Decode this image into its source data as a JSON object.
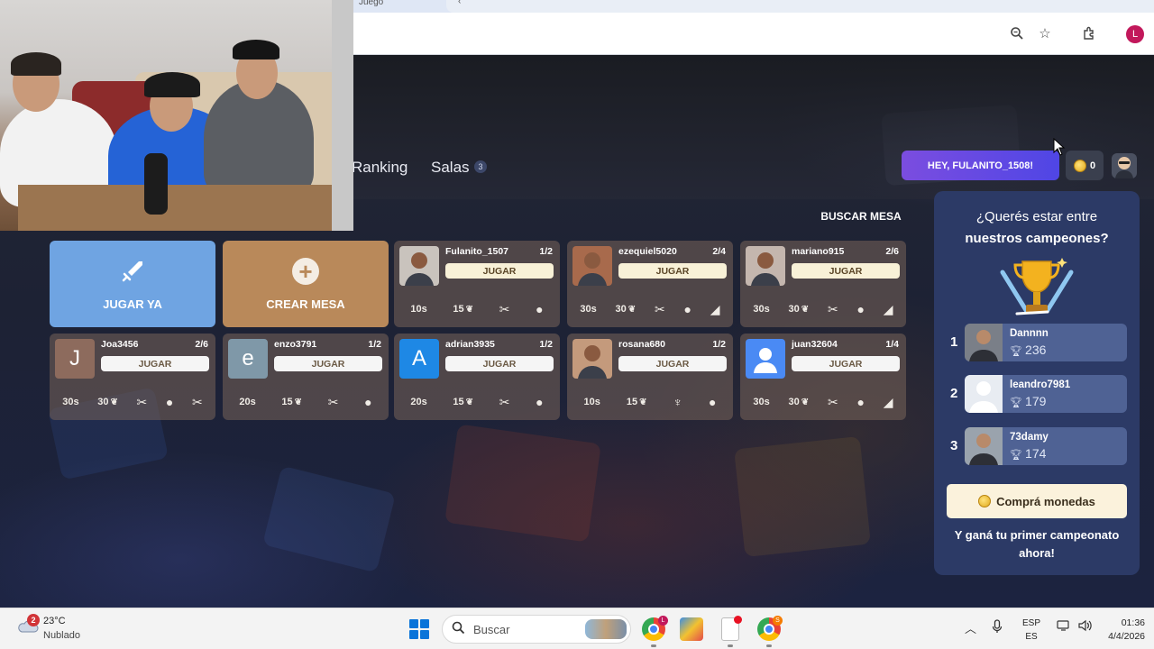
{
  "browser": {
    "tab_fragment": "Juego",
    "icons": [
      "zoom-icon",
      "star-icon",
      "extensions-icon"
    ],
    "profile_initial": "L"
  },
  "nav": {
    "ranking": "Ranking",
    "salas": "Salas",
    "salas_count": "3"
  },
  "header": {
    "greeting": "HEY, FULANITO_1508!",
    "coins": "0"
  },
  "search_table": "BUSCAR MESA",
  "actions": {
    "play_now": "JUGAR YA",
    "create_table": "CREAR MESA"
  },
  "tables": [
    {
      "player": "Fulanito_1507",
      "count": "1/2",
      "join": "JUGAR",
      "time": "10s",
      "points": "15",
      "avatar": "photo"
    },
    {
      "player": "ezequiel5020",
      "count": "2/4",
      "join": "JUGAR",
      "time": "30s",
      "points": "30",
      "avatar": "photo"
    },
    {
      "player": "mariano915",
      "count": "2/6",
      "join": "JUGAR",
      "time": "30s",
      "points": "30",
      "avatar": "photo"
    },
    {
      "player": "Joa3456",
      "count": "2/6",
      "join": "JUGAR",
      "time": "30s",
      "points": "30",
      "avatar": "J"
    },
    {
      "player": "enzo3791",
      "count": "1/2",
      "join": "JUGAR",
      "time": "20s",
      "points": "15",
      "avatar": "e"
    },
    {
      "player": "adrian3935",
      "count": "1/2",
      "join": "JUGAR",
      "time": "20s",
      "points": "15",
      "avatar": "A"
    },
    {
      "player": "rosana680",
      "count": "1/2",
      "join": "JUGAR",
      "time": "10s",
      "points": "15",
      "avatar": "photo"
    },
    {
      "player": "juan32604",
      "count": "1/4",
      "join": "JUGAR",
      "time": "30s",
      "points": "30",
      "avatar": "user-icon"
    }
  ],
  "champions": {
    "title_line1": "¿Querés estar entre",
    "title_line2": "nuestros campeones?",
    "ranking": [
      {
        "pos": "1",
        "name": "Dannnn",
        "score": "236"
      },
      {
        "pos": "2",
        "name": "leandro7981",
        "score": "179"
      },
      {
        "pos": "3",
        "name": "73damy",
        "score": "174"
      }
    ],
    "buy_button": "Comprá monedas",
    "promo": "Y ganá tu primer campeonato ahora!"
  },
  "taskbar": {
    "weather_badge": "2",
    "temperature": "23°C",
    "weather": "Nublado",
    "search_placeholder": "Buscar",
    "chrome_badge": "L",
    "chrome2_badge": "S",
    "lang_top": "ESP",
    "lang_bottom": "ES",
    "time": "01:36",
    "date": "4/4/2026"
  },
  "colors": {
    "accent_purple": "#7b4de0",
    "play_blue": "#6fa4e2",
    "create_brown": "#b9895a",
    "panel_navy": "#2c3a66"
  }
}
